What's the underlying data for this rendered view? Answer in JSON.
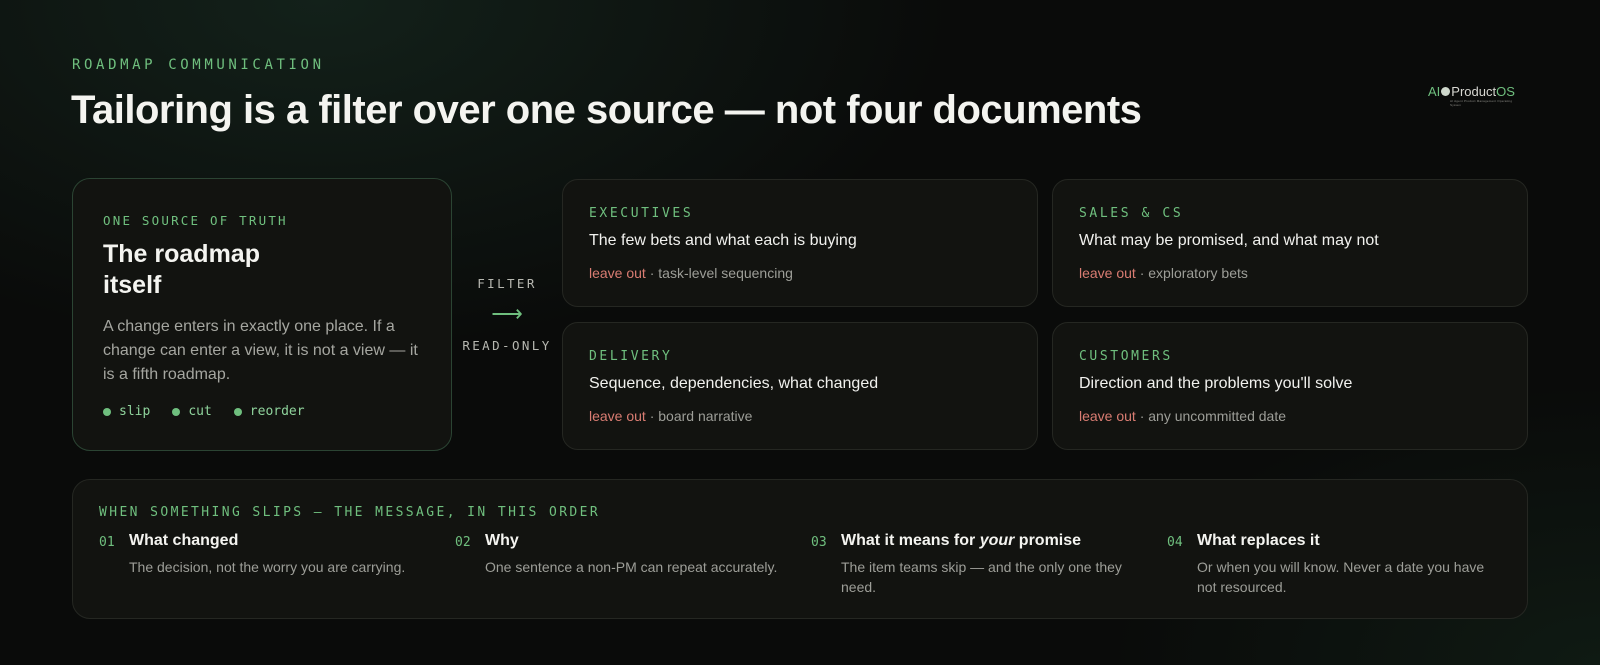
{
  "eyebrow": "ROADMAP COMMUNICATION",
  "title": "Tailoring is a filter over one source — not four documents",
  "logo": {
    "prefix": "AI",
    "name": "Product",
    "suffix": "OS",
    "tagline": "AI Agent Product Management Operating System"
  },
  "source": {
    "eyebrow": "ONE SOURCE OF TRUTH",
    "title": "The roadmap itself",
    "body": "A change enters in exactly one place. If a change can enter a view, it is not a view — it is a fifth roadmap.",
    "tags": [
      "slip",
      "cut",
      "reorder"
    ]
  },
  "filter": {
    "top_label": "FILTER",
    "arrow": "⟶",
    "bottom_label": "READ-ONLY"
  },
  "audiences": [
    {
      "eyebrow": "EXECUTIVES",
      "headline": "The few bets and what each is buying",
      "leave_label": "leave out",
      "leave_value": " · task-level sequencing"
    },
    {
      "eyebrow": "SALES & CS",
      "headline": "What may be promised, and what may not",
      "leave_label": "leave out",
      "leave_value": " · exploratory bets"
    },
    {
      "eyebrow": "DELIVERY",
      "headline": "Sequence, dependencies, what changed",
      "leave_label": "leave out",
      "leave_value": " · board narrative"
    },
    {
      "eyebrow": "CUSTOMERS",
      "headline": "Direction and the problems you'll solve",
      "leave_label": "leave out",
      "leave_value": " · any uncommitted date"
    }
  ],
  "slip": {
    "eyebrow": "WHEN SOMETHING SLIPS — THE MESSAGE, IN THIS ORDER",
    "steps": [
      {
        "num": "01",
        "title": "What changed",
        "title_em": "",
        "title_after": "",
        "desc": "The decision, not the worry you are carrying."
      },
      {
        "num": "02",
        "title": "Why",
        "title_em": "",
        "title_after": "",
        "desc": "One sentence a non-PM can repeat accurately."
      },
      {
        "num": "03",
        "title": "What it means for ",
        "title_em": "your",
        "title_after": " promise",
        "desc": "The item teams skip — and the only one they need."
      },
      {
        "num": "04",
        "title": "What replaces it",
        "title_em": "",
        "title_after": "",
        "desc": "Or when you will know. Never a date you have not resourced."
      }
    ]
  }
}
